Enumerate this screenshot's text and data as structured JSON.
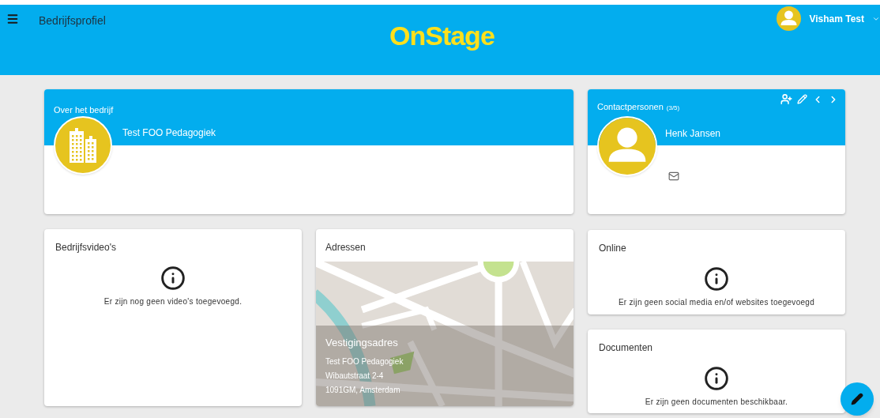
{
  "header": {
    "title": "Bedrijfsprofiel",
    "logo": "OnStage",
    "user": "Visham Test"
  },
  "about": {
    "title": "Over het bedrijf",
    "company": "Test FOO Pedagogiek"
  },
  "contacts": {
    "title": "Contactpersonen",
    "count": "(3/5)",
    "name": "Henk Jansen"
  },
  "videos": {
    "title": "Bedrijfsvideo's",
    "message": "Er zijn nog geen video's toegevoegd."
  },
  "addresses": {
    "title": "Adressen",
    "label": "Vestigingsadres",
    "lines": [
      "Test FOO Pedagogiek",
      "Wibautstraat 2-4",
      "1091GM, Amsterdam"
    ]
  },
  "online": {
    "title": "Online",
    "message": "Er zijn geen social media en/of websites toegevoegd"
  },
  "documents": {
    "title": "Documenten",
    "message": "Er zijn geen documenten beschikbaar."
  }
}
